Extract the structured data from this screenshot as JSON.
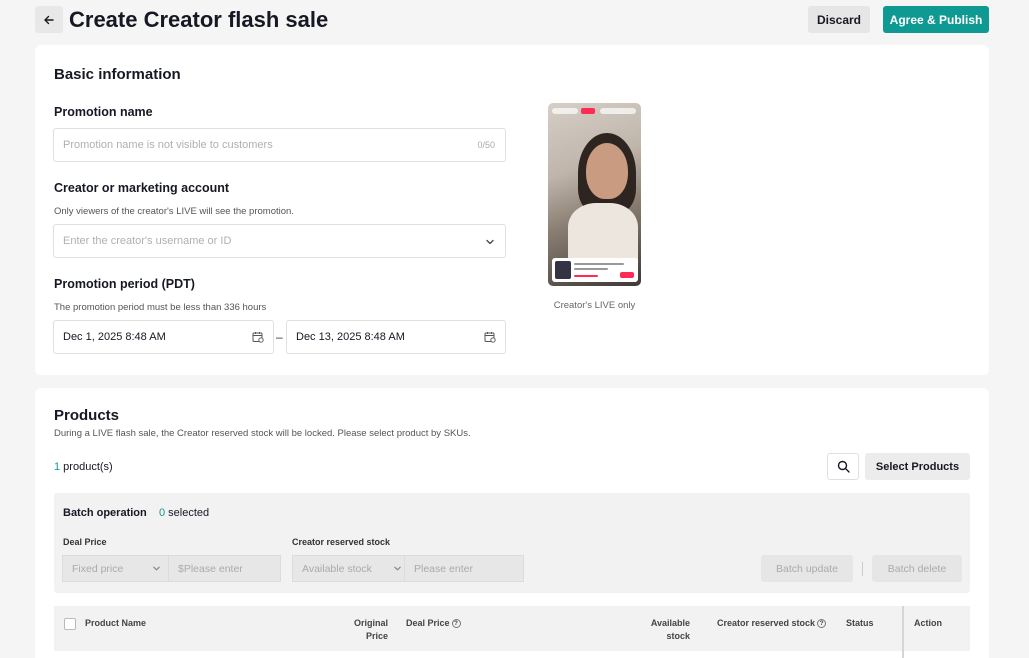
{
  "header": {
    "title": "Create Creator flash sale",
    "discard_label": "Discard",
    "publish_label": "Agree & Publish"
  },
  "basic": {
    "section_title": "Basic information",
    "promotion_name": {
      "label": "Promotion name",
      "placeholder": "Promotion name is not visible to customers",
      "counter": "0/50"
    },
    "creator": {
      "label": "Creator or marketing account",
      "hint": "Only viewers of the creator's LIVE will see the promotion.",
      "placeholder": "Enter the creator's username or ID"
    },
    "period": {
      "label": "Promotion period (PDT)",
      "hint": "The promotion period must be less than 336 hours",
      "start": "Dec 1, 2025 8:48 AM",
      "separator": "–",
      "end": "Dec 13, 2025 8:48 AM"
    },
    "preview_caption": "Creator's LIVE only"
  },
  "products": {
    "section_title": "Products",
    "subtitle": "During a LIVE flash sale, the Creator reserved stock will be locked. Please select product by SKUs.",
    "count": "1",
    "count_suffix": " product(s)",
    "select_label": "Select Products",
    "batch": {
      "title": "Batch operation",
      "selected_count": "0",
      "selected_suffix": " selected",
      "deal_price_label": "Deal Price",
      "deal_price_type": "Fixed price",
      "deal_price_placeholder": "$Please enter",
      "stock_label": "Creator reserved stock",
      "stock_type": "Available stock",
      "stock_placeholder": "Please enter",
      "update_label": "Batch update",
      "delete_label": "Batch delete"
    },
    "table": {
      "col_product": "Product Name",
      "col_original_1": "Original",
      "col_original_2": "Price",
      "col_deal": "Deal Price",
      "col_available_1": "Available",
      "col_available_2": "stock",
      "col_reserved": "Creator reserved stock",
      "col_status": "Status",
      "col_action": "Action"
    }
  },
  "icons": {
    "back": "arrow-left-icon",
    "calendar": "calendar-icon",
    "chevron": "chevron-down-icon",
    "search": "search-icon",
    "help": "question-circle-icon"
  },
  "colors": {
    "accent": "#0f9993",
    "background": "#f5f5f5",
    "live_badge": "#fe2c55"
  }
}
